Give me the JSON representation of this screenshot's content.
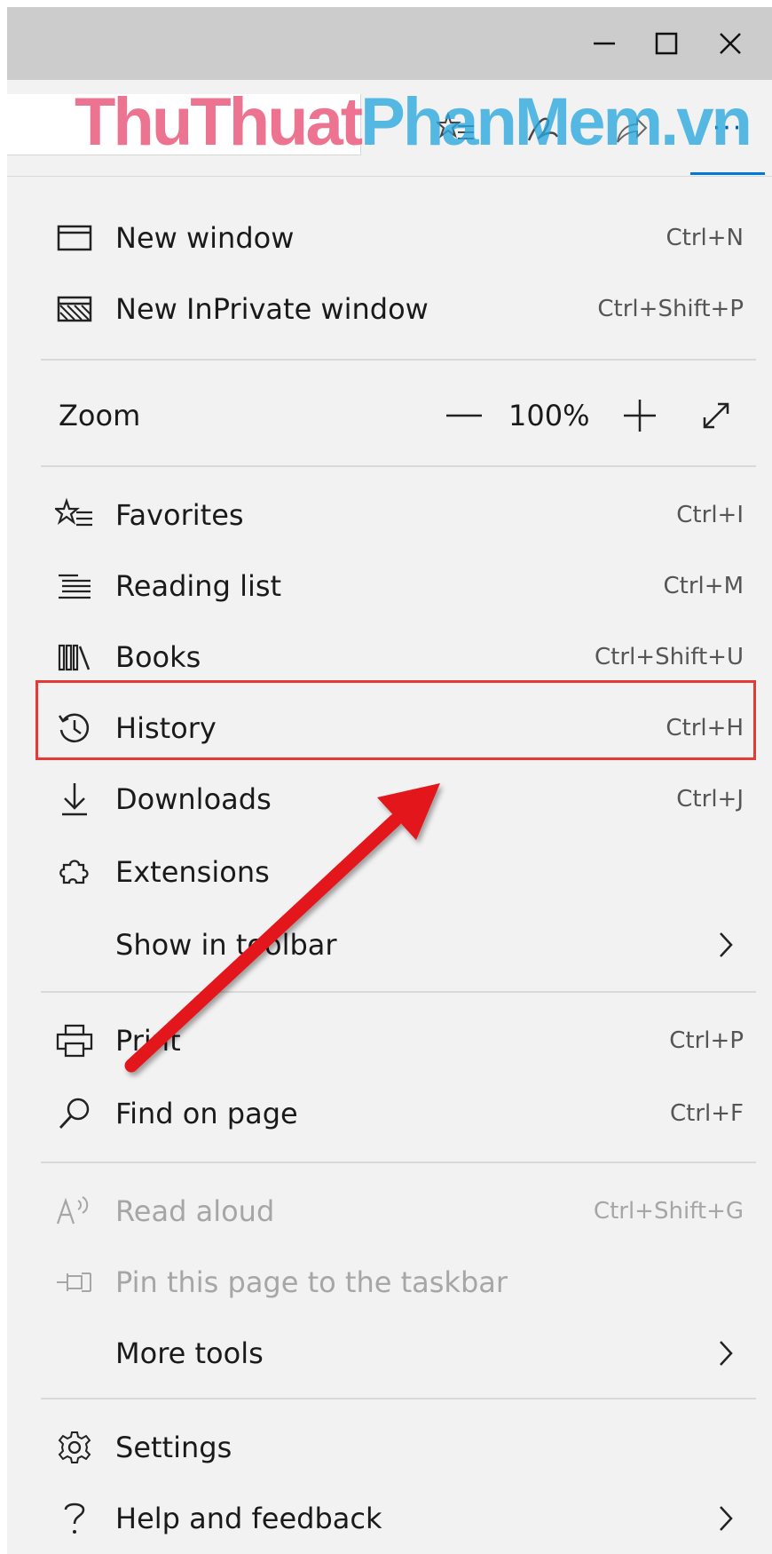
{
  "window_controls": {
    "minimize": "—",
    "maximize": "□",
    "close": "✕"
  },
  "watermark": {
    "part1": "ThuThuat",
    "part2": "PhanMem.vn"
  },
  "toolbar": {
    "more_label": "···"
  },
  "menu": {
    "new_window": {
      "label": "New window",
      "shortcut": "Ctrl+N"
    },
    "new_inprivate": {
      "label": "New InPrivate window",
      "shortcut": "Ctrl+Shift+P"
    },
    "zoom": {
      "label": "Zoom",
      "value": "100%"
    },
    "favorites": {
      "label": "Favorites",
      "shortcut": "Ctrl+I"
    },
    "reading_list": {
      "label": "Reading list",
      "shortcut": "Ctrl+M"
    },
    "books": {
      "label": "Books",
      "shortcut": "Ctrl+Shift+U"
    },
    "history": {
      "label": "History",
      "shortcut": "Ctrl+H"
    },
    "downloads": {
      "label": "Downloads",
      "shortcut": "Ctrl+J"
    },
    "extensions": {
      "label": "Extensions"
    },
    "show_in_toolbar": {
      "label": "Show in toolbar"
    },
    "print": {
      "label": "Print",
      "shortcut": "Ctrl+P"
    },
    "find_on_page": {
      "label": "Find on page",
      "shortcut": "Ctrl+F"
    },
    "read_aloud": {
      "label": "Read aloud",
      "shortcut": "Ctrl+Shift+G"
    },
    "pin_taskbar": {
      "label": "Pin this page to the taskbar"
    },
    "more_tools": {
      "label": "More tools"
    },
    "settings": {
      "label": "Settings"
    },
    "help_feedback": {
      "label": "Help and feedback"
    }
  },
  "colors": {
    "highlight": "#e53935",
    "arrow": "#e3161c",
    "accent": "#0078d7"
  }
}
